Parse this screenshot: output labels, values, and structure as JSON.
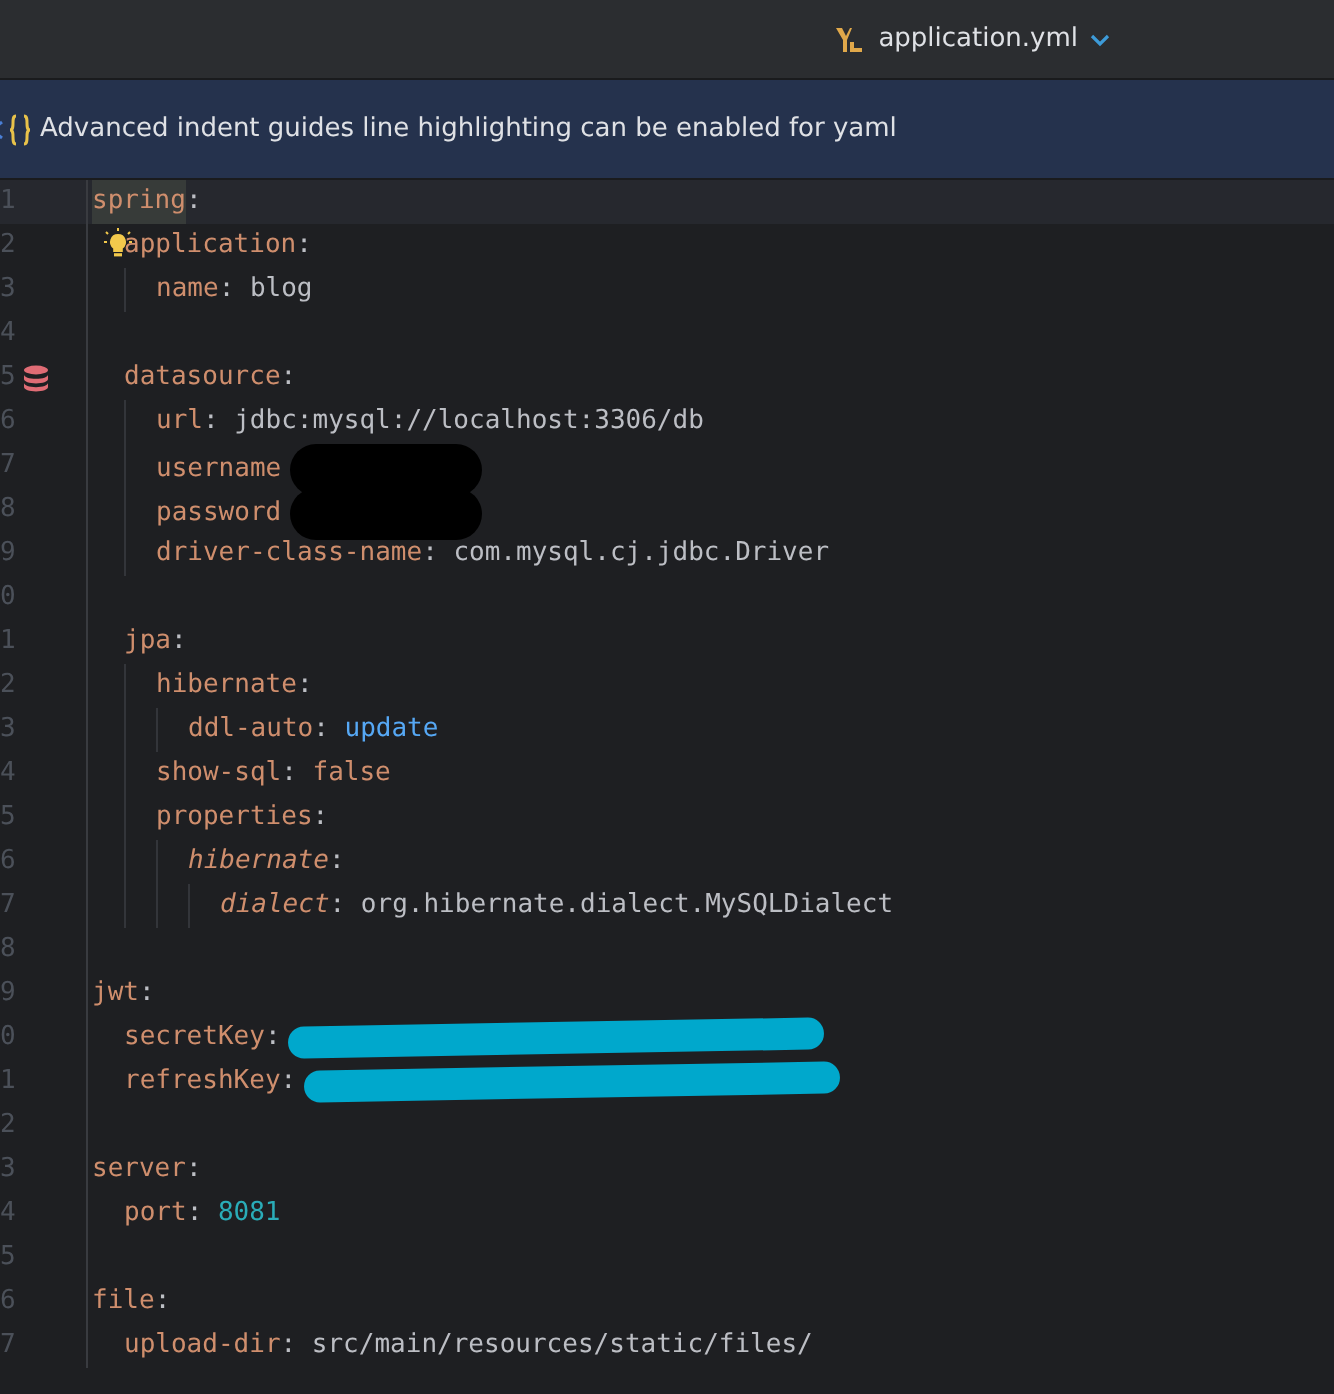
{
  "tab": {
    "title": "application.yml"
  },
  "banner": {
    "text": "Advanced indent guides line highlighting can be enabled for yaml"
  },
  "lines": [
    {
      "number": "1",
      "key": "spring",
      "sep": ":",
      "key_highlighted": true,
      "current": true,
      "children": [
        {
          "number": "2",
          "key": "application",
          "sep": ":",
          "intention_bulb": true,
          "children": [
            {
              "number": "3",
              "key": "name",
              "sep": ":",
              "value": "blog",
              "kind": "string"
            }
          ]
        },
        {
          "number": "4"
        },
        {
          "number": "5",
          "key": "datasource",
          "sep": ":",
          "database_marker": true,
          "children": [
            {
              "number": "6",
              "key": "url",
              "sep": ":",
              "value": "jdbc:mysql://localhost:3306/db",
              "kind": "string"
            },
            {
              "number": "7",
              "key": "username",
              "redaction": {
                "color": "#000000"
              }
            },
            {
              "number": "8",
              "key": "password",
              "redaction": {
                "color": "#000000"
              }
            },
            {
              "number": "9",
              "key": "driver-class-name",
              "sep": ":",
              "value": "com.mysql.cj.jdbc.Driver",
              "kind": "string"
            }
          ]
        },
        {
          "number": "0"
        },
        {
          "number": "1",
          "key": "jpa",
          "sep": ":",
          "children": [
            {
              "number": "2",
              "key": "hibernate",
              "sep": ":",
              "children": [
                {
                  "number": "3",
                  "key": "ddl-auto",
                  "sep": ":",
                  "value": "update",
                  "kind": "keyword"
                }
              ]
            },
            {
              "number": "4",
              "key": "show-sql",
              "sep": ":",
              "value": "false",
              "kind": "boolean"
            },
            {
              "number": "5",
              "key": "properties",
              "sep": ":",
              "children": [
                {
                  "number": "6",
                  "key": "hibernate",
                  "sep": ":",
                  "key_italic": true,
                  "children": [
                    {
                      "number": "7",
                      "key": "dialect",
                      "sep": ":",
                      "key_italic": true,
                      "value": "org.hibernate.dialect.MySQLDialect",
                      "kind": "string"
                    }
                  ]
                }
              ]
            }
          ]
        }
      ]
    },
    {
      "number": "8"
    },
    {
      "number": "9",
      "key": "jwt",
      "sep": ":",
      "children": [
        {
          "number": "0",
          "key": "secretKey",
          "sep": ":",
          "redaction": {
            "color": "#00a8cc"
          }
        },
        {
          "number": "1",
          "key": "refreshKey",
          "sep": ":",
          "redaction": {
            "color": "#00a8cc"
          }
        }
      ]
    },
    {
      "number": "2"
    },
    {
      "number": "3",
      "key": "server",
      "sep": ":",
      "children": [
        {
          "number": "4",
          "key": "port",
          "sep": ":",
          "value": "8081",
          "kind": "number"
        }
      ]
    },
    {
      "number": "5"
    },
    {
      "number": "6",
      "key": "file",
      "sep": ":",
      "children": [
        {
          "number": "7",
          "key": "upload-dir",
          "sep": ":",
          "value": "src/main/resources/static/files/",
          "kind": "string"
        }
      ]
    }
  ]
}
